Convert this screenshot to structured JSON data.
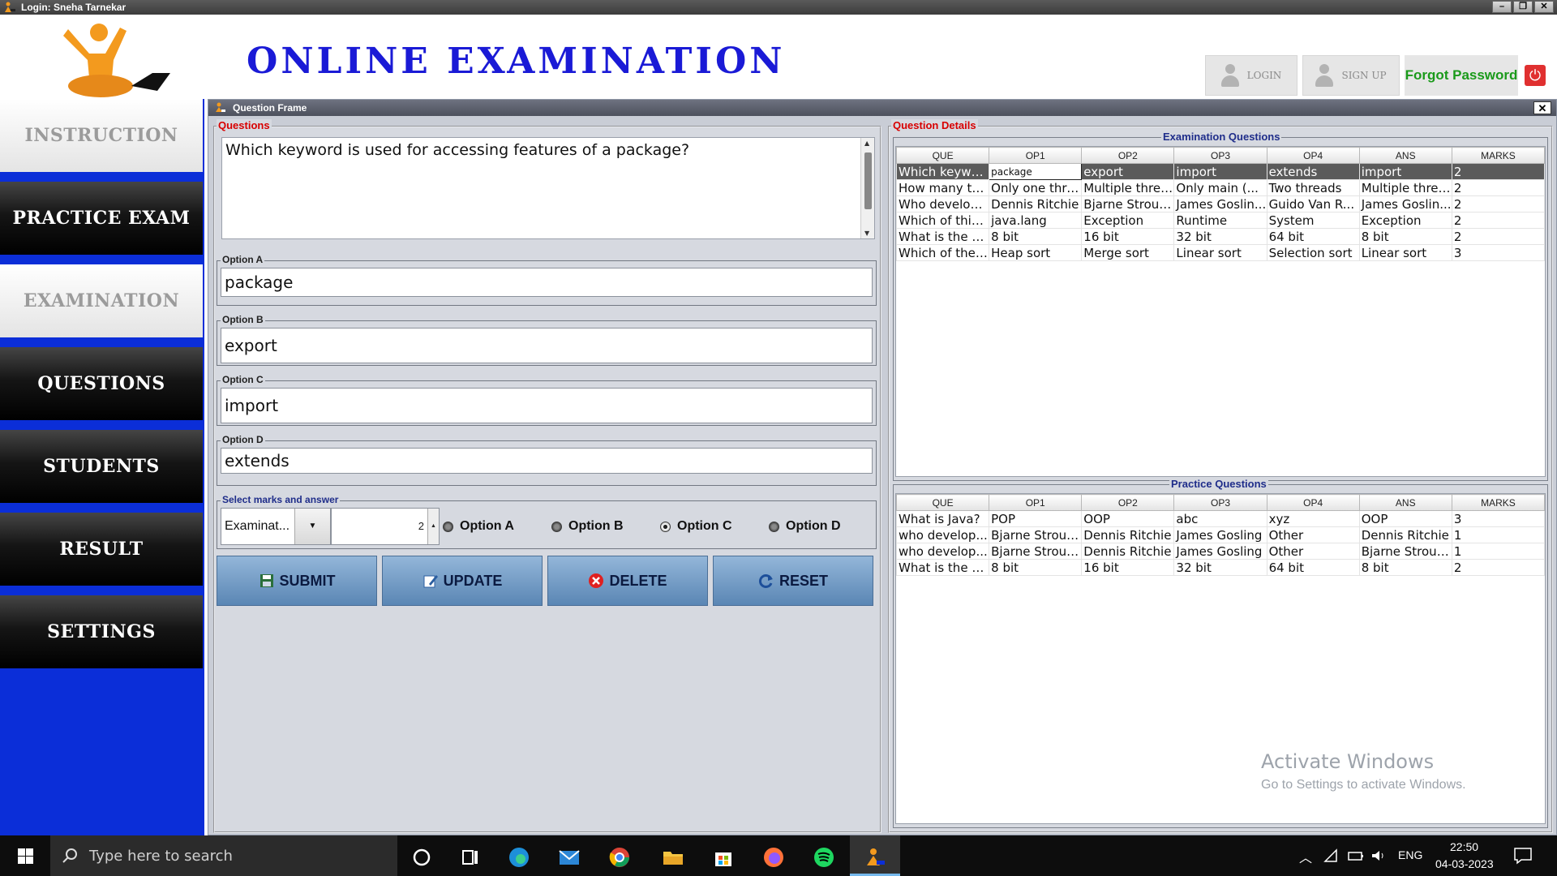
{
  "window": {
    "title": "Login: Sneha Tarnekar",
    "buttons": [
      "–",
      "❐",
      "✕"
    ]
  },
  "header": {
    "app_title": "ONLINE EXAMINATION",
    "login_label": "LOGIN",
    "signup_label": "SIGN UP",
    "forgot_label": "Forgot Password"
  },
  "sidebar": {
    "items": [
      {
        "label": "INSTRUCTION",
        "style": "light"
      },
      {
        "label": "PRACTICE EXAM",
        "style": "dark"
      },
      {
        "label": "EXAMINATION",
        "style": "light"
      },
      {
        "label": "QUESTIONS",
        "style": "dark"
      },
      {
        "label": "STUDENTS",
        "style": "dark"
      },
      {
        "label": "RESULT",
        "style": "dark"
      },
      {
        "label": "SETTINGS",
        "style": "dark"
      }
    ],
    "accent": "#0b2ed8"
  },
  "frame": {
    "title": "Question Frame",
    "close_label": "✕",
    "questions_legend": "Questions",
    "question_text": "Which keyword is used for accessing features of a package?",
    "options": [
      {
        "label": "Option A",
        "value": "package"
      },
      {
        "label": "Option B",
        "value": "export"
      },
      {
        "label": "Option C",
        "value": "import"
      },
      {
        "label": "Option D",
        "value": "extends"
      }
    ],
    "marks_legend": "Select marks and answer",
    "type_value": "Examinat...",
    "marks_value": "2",
    "radio": [
      {
        "label": "Option A",
        "selected": false
      },
      {
        "label": "Option B",
        "selected": false
      },
      {
        "label": "Option C",
        "selected": true
      },
      {
        "label": "Option D",
        "selected": false
      }
    ],
    "buttons": {
      "submit": "SUBMIT",
      "update": "UPDATE",
      "delete": "DELETE",
      "reset": "RESET"
    }
  },
  "details": {
    "legend": "Question Details",
    "columns": [
      "QUE",
      "OP1",
      "OP2",
      "OP3",
      "OP4",
      "ANS",
      "MARKS"
    ],
    "exam": {
      "title": "Examination Questions",
      "rows": [
        [
          "Which keywo...",
          "package",
          "export",
          "import",
          "extends",
          "import",
          "2"
        ],
        [
          "How many th...",
          "Only one thre...",
          "Multiple threads",
          "Only main (...",
          "Two threads",
          "Multiple threads",
          "2"
        ],
        [
          "Who develop...",
          "Dennis Ritchie",
          "Bjarne Strous...",
          "James Goslin...",
          "Guido Van R...",
          "James Goslin...",
          "2"
        ],
        [
          "Which of this ...",
          "java.lang",
          "Exception",
          "Runtime",
          "System",
          "Exception",
          "2"
        ],
        [
          "What is the si...",
          "8 bit",
          "16 bit",
          "32 bit",
          "64 bit",
          "8 bit",
          "2"
        ],
        [
          "Which of the ...",
          "Heap sort",
          "Merge sort",
          "Linear sort",
          "Selection sort",
          "Linear sort",
          "3"
        ]
      ]
    },
    "practice": {
      "title": "Practice Questions",
      "rows": [
        [
          "What is Java?",
          "POP",
          "OOP",
          "abc",
          "xyz",
          "OOP",
          "3"
        ],
        [
          "who develop...",
          "Bjarne Strous...",
          "Dennis Ritchie",
          "James Gosling",
          "Other",
          "Dennis Ritchie",
          "1"
        ],
        [
          "who develop...",
          "Bjarne Strous...",
          "Dennis Ritchie",
          "James Gosling",
          "Other",
          "Bjarne Strous...",
          "1"
        ],
        [
          "What is the si...",
          "8 bit",
          "16 bit",
          "32 bit",
          "64 bit",
          "8 bit",
          "2"
        ]
      ]
    }
  },
  "watermark": {
    "line1": "Activate Windows",
    "line2": "Go to Settings to activate Windows."
  },
  "taskbar": {
    "search_placeholder": "Type here to search",
    "lang": "ENG",
    "time": "22:50",
    "date": "04-03-2023"
  }
}
